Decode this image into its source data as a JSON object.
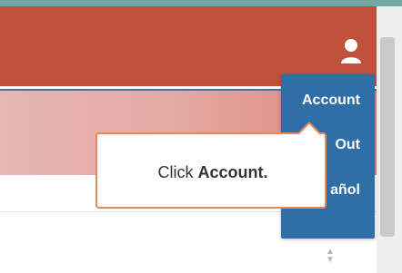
{
  "header": {
    "user_icon": "user-icon"
  },
  "menu": {
    "items": [
      {
        "label": "Account"
      },
      {
        "label": "Out"
      },
      {
        "label": "añol"
      }
    ]
  },
  "tooltip": {
    "prefix": "Click",
    "target": "Account."
  },
  "colors": {
    "header": "#c0513a",
    "menu": "#2f6ea7",
    "callout_border": "#e58a55",
    "top_strip": "#6fa8a5"
  },
  "stepper": {
    "up": "▲",
    "down": "▼"
  }
}
